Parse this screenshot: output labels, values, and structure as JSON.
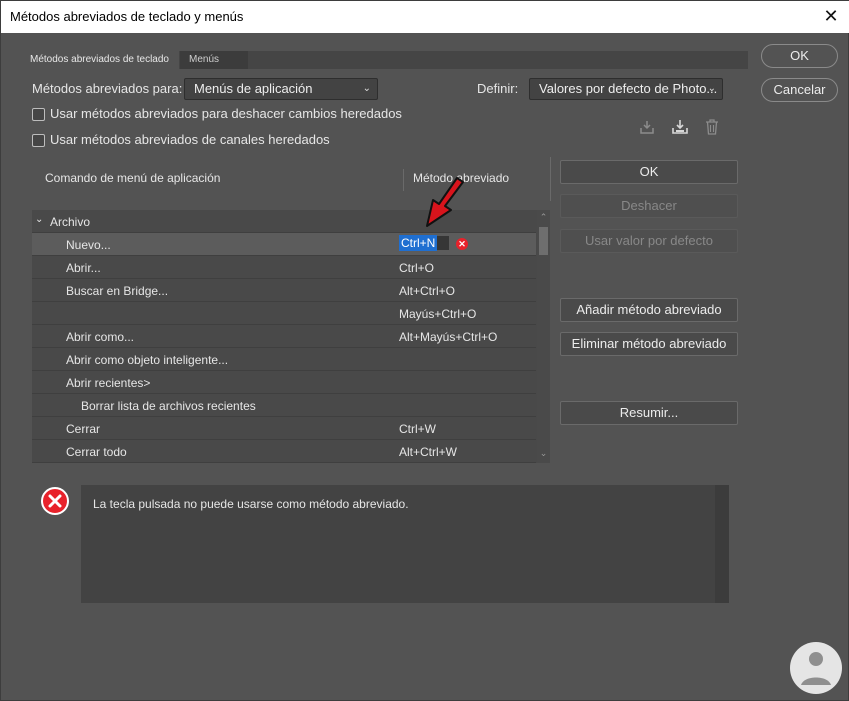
{
  "window": {
    "title": "Métodos abreviados de teclado y menús"
  },
  "tabs": [
    {
      "label": "Métodos abreviados de teclado"
    },
    {
      "label": "Menús"
    }
  ],
  "controls": {
    "shortcuts_for_label": "Métodos abreviados para:",
    "shortcuts_for_value": "Menús de aplicación",
    "define_label": "Definir:",
    "define_value": "Valores por defecto de Photo...",
    "checkbox_undo_label": "Usar métodos abreviados para deshacer cambios heredados",
    "checkbox_channels_label": "Usar métodos abreviados de canales heredados"
  },
  "table": {
    "col_command": "Comando de menú de aplicación",
    "col_shortcut": "Método abreviado",
    "group": "Archivo",
    "rows": [
      {
        "cmd": "Nuevo...",
        "sc": "Ctrl+N"
      },
      {
        "cmd": "Abrir...",
        "sc": "Ctrl+O"
      },
      {
        "cmd": "Buscar en Bridge...",
        "sc": "Alt+Ctrl+O"
      },
      {
        "cmd": "",
        "sc": "Mayús+Ctrl+O"
      },
      {
        "cmd": "Abrir como...",
        "sc": "Alt+Mayús+Ctrl+O"
      },
      {
        "cmd": "Abrir como objeto inteligente...",
        "sc": ""
      },
      {
        "cmd": "Abrir recientes>",
        "sc": ""
      },
      {
        "cmd": "Borrar lista de archivos recientes",
        "sc": ""
      },
      {
        "cmd": "Cerrar",
        "sc": "Ctrl+W"
      },
      {
        "cmd": "Cerrar todo",
        "sc": "Alt+Ctrl+W"
      }
    ]
  },
  "side_buttons": {
    "ok": "OK",
    "undo": "Deshacer",
    "use_default": "Usar valor por defecto",
    "add": "Añadir método abreviado",
    "delete": "Eliminar método abreviado",
    "summarize": "Resumir..."
  },
  "dialog_buttons": {
    "ok": "OK",
    "cancel": "Cancelar"
  },
  "message": {
    "text": "La tecla pulsada no puede usarse como método abreviado."
  },
  "colors": {
    "error": "#e8222b",
    "arrow": "#d8141c",
    "selection": "#1f6fd1"
  }
}
